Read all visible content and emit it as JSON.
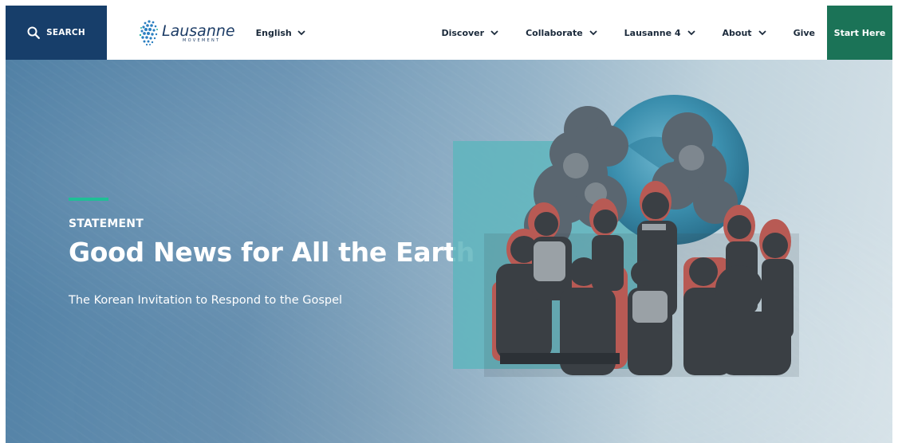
{
  "header": {
    "search_label": "SEARCH",
    "logo": {
      "wordmark": "Lausanne",
      "tagline": "MOVEMENT"
    },
    "language": "English",
    "menu": [
      {
        "label": "Discover",
        "has_dropdown": true
      },
      {
        "label": "Collaborate",
        "has_dropdown": true
      },
      {
        "label": "Lausanne 4",
        "has_dropdown": true
      },
      {
        "label": "About",
        "has_dropdown": true
      },
      {
        "label": "Give",
        "has_dropdown": false
      }
    ],
    "cta_label": "Start Here"
  },
  "hero": {
    "eyebrow": "STATEMENT",
    "title": "Good News for All the Earth",
    "subtitle": "The Korean Invitation to Respond to the Gospel"
  },
  "icons": {
    "search": "search-icon",
    "dropdown": "chevron-down-icon",
    "logo": "globe-dots-logo-icon"
  },
  "colors": {
    "search_bg": "#173e6a",
    "cta_bg": "#1b7357",
    "accent": "#1fbf96",
    "nav_text": "#1b2a3b",
    "hero_bg": "#6a93b3"
  }
}
